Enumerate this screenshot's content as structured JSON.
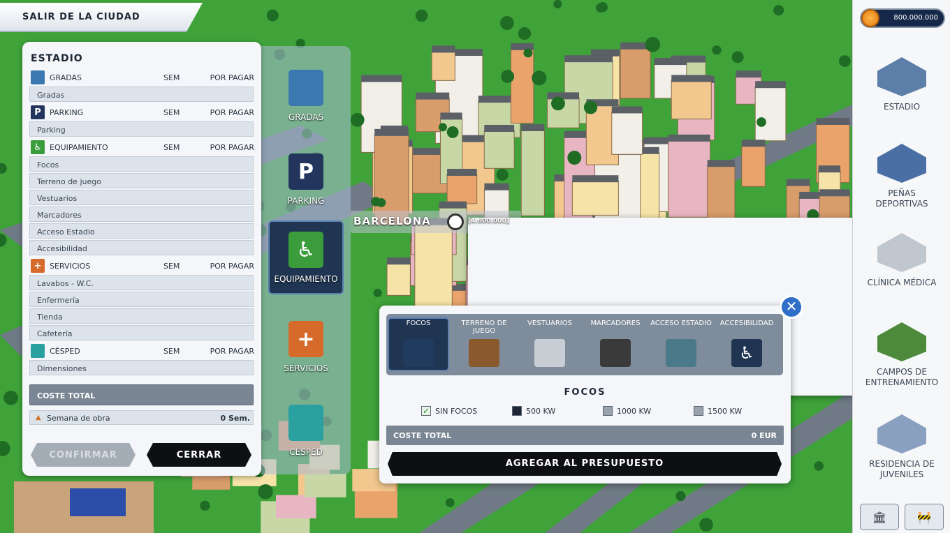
{
  "exit_label": "SALIR DE LA CIUDAD",
  "money": "800.000.000",
  "stadium_panel": {
    "title": "ESTADIO",
    "categories": [
      {
        "name": "GRADAS",
        "weeks": "SEM",
        "payment": "POR PAGAR",
        "icon": "stands-icon",
        "items": [
          "Gradas"
        ]
      },
      {
        "name": "PARKING",
        "weeks": "SEM",
        "payment": "POR PAGAR",
        "icon": "parking-icon",
        "items": [
          "Parking"
        ]
      },
      {
        "name": "EQUIPAMIENTO",
        "weeks": "SEM",
        "payment": "POR PAGAR",
        "icon": "equipment-icon",
        "items": [
          "Focos",
          "Terreno de juego",
          "Vestuarios",
          "Marcadores",
          "Acceso Estadio",
          "Accesibilidad"
        ]
      },
      {
        "name": "SERVICIOS",
        "weeks": "SEM",
        "payment": "POR PAGAR",
        "icon": "services-icon",
        "items": [
          "Lavabos - W.C.",
          "Enfermería",
          "Tienda",
          "Cafetería"
        ]
      },
      {
        "name": "CÉSPED",
        "weeks": "SEM",
        "payment": "POR PAGAR",
        "icon": "grass-icon",
        "items": [
          "Dimensiones"
        ]
      }
    ],
    "total_label": "COSTE TOTAL",
    "weeks_label": "Semana de obra",
    "weeks_value": "0 Sem.",
    "confirm_label": "CONFIRMAR",
    "close_label": "CERRAR"
  },
  "category_column": [
    {
      "label": "GRADAS",
      "icon": "stands-icon",
      "selected": false
    },
    {
      "label": "PARKING",
      "icon": "parking-icon",
      "selected": false
    },
    {
      "label": "EQUIPAMIENTO",
      "icon": "equipment-icon",
      "selected": true
    },
    {
      "label": "SERVICIOS",
      "icon": "services-icon",
      "selected": false
    },
    {
      "label": "CÉSPED",
      "icon": "grass-icon",
      "selected": false
    }
  ],
  "city": {
    "name": "BARCELONA",
    "population": "[4.600.000]"
  },
  "right_nav": [
    {
      "label": "ESTADIO",
      "icon": "stadium-icon"
    },
    {
      "label": "PEÑAS\nDEPORTIVAS",
      "icon": "fan-club-icon"
    },
    {
      "label": "CLÍNICA MÉDICA",
      "icon": "clinic-icon"
    },
    {
      "label": "CAMPOS DE\nENTRENAMIENTO",
      "icon": "training-fields-icon"
    },
    {
      "label": "RESIDENCIA DE\nJUVENILES",
      "icon": "youth-residence-icon"
    }
  ],
  "equipment_popup": {
    "tabs": [
      {
        "label": "FOCOS",
        "icon": "floodlight-icon",
        "selected": true
      },
      {
        "label": "TERRENO DE JUEGO",
        "icon": "pitch-icon",
        "selected": false
      },
      {
        "label": "VESTUARIOS",
        "icon": "lockers-icon",
        "selected": false
      },
      {
        "label": "MARCADORES",
        "icon": "scoreboard-icon",
        "selected": false
      },
      {
        "label": "ACCESO ESTADIO",
        "icon": "turnstile-icon",
        "selected": false
      },
      {
        "label": "ACCESIBILIDAD",
        "icon": "wheelchair-icon",
        "selected": false
      }
    ],
    "title": "FOCOS",
    "options": [
      {
        "label": "SIN FOCOS",
        "checked": true
      },
      {
        "label": "500 KW",
        "checked": false
      },
      {
        "label": "1000 KW",
        "checked": false
      },
      {
        "label": "1500 KW",
        "checked": false
      }
    ],
    "total_label": "COSTE TOTAL",
    "total_value": "0 EUR",
    "add_label": "AGREGAR AL PRESUPUESTO"
  },
  "colors": {
    "accent_blue": "#2f6fc8",
    "panel_dark": "#1f3552",
    "grass": "#3fa33a"
  }
}
